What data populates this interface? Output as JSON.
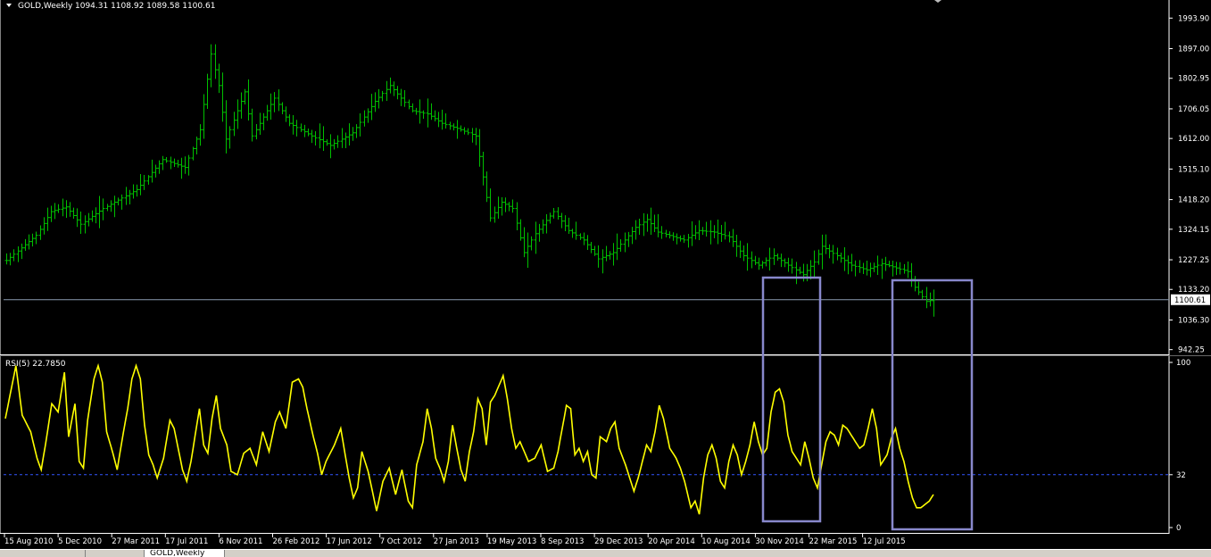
{
  "header": {
    "symbol": "GOLD,Weekly",
    "ohlc": "1094.31 1108.92 1089.58 1100.61"
  },
  "colors": {
    "background": "#000000",
    "bars": "#00c000",
    "rsi": "#ffff00",
    "level": "#3355ff",
    "price_line": "#8a9bb0",
    "box": "#8888cc",
    "axis_text": "#ffffff",
    "separator": "#ffffff"
  },
  "tabs": [
    "",
    "",
    "GOLD,Weekly"
  ],
  "chart_data": [
    {
      "type": "ohlc",
      "title": "GOLD,Weekly",
      "x_axis_labels": [
        "15 Aug 2010",
        "5 Dec 2010",
        "27 Mar 2011",
        "17 Jul 2011",
        "6 Nov 2011",
        "26 Feb 2012",
        "17 Jun 2012",
        "7 Oct 2012",
        "27 Jan 2013",
        "19 May 2013",
        "8 Sep 2013",
        "29 Dec 2013",
        "20 Apr 2014",
        "10 Aug 2014",
        "30 Nov 2014",
        "22 Mar 2015",
        "12 Jul 2015"
      ],
      "y_ticks": [
        "1993.90",
        "1897.00",
        "1802.95",
        "1706.05",
        "1612.00",
        "1515.10",
        "1418.20",
        "1324.15",
        "1227.25",
        "1133.20",
        "1036.30",
        "942.25"
      ],
      "ylim": [
        930,
        2040
      ],
      "current_price": 1100.61,
      "current_price_label": "1100.61",
      "anchors": [
        [
          0,
          1225
        ],
        [
          8,
          1305
        ],
        [
          12,
          1380
        ],
        [
          16,
          1395
        ],
        [
          20,
          1340
        ],
        [
          26,
          1390
        ],
        [
          35,
          1450
        ],
        [
          42,
          1545
        ],
        [
          48,
          1520
        ],
        [
          52,
          1640
        ],
        [
          55,
          1880
        ],
        [
          57,
          1780
        ],
        [
          59,
          1610
        ],
        [
          62,
          1700
        ],
        [
          64,
          1760
        ],
        [
          66,
          1620
        ],
        [
          70,
          1700
        ],
        [
          72,
          1740
        ],
        [
          76,
          1660
        ],
        [
          82,
          1620
        ],
        [
          87,
          1590
        ],
        [
          93,
          1630
        ],
        [
          99,
          1730
        ],
        [
          103,
          1780
        ],
        [
          109,
          1700
        ],
        [
          113,
          1690
        ],
        [
          117,
          1660
        ],
        [
          122,
          1640
        ],
        [
          126,
          1620
        ],
        [
          130,
          1360
        ],
        [
          133,
          1410
        ],
        [
          136,
          1390
        ],
        [
          139,
          1250
        ],
        [
          142,
          1310
        ],
        [
          147,
          1380
        ],
        [
          151,
          1320
        ],
        [
          155,
          1290
        ],
        [
          159,
          1230
        ],
        [
          163,
          1250
        ],
        [
          169,
          1330
        ],
        [
          172,
          1355
        ],
        [
          175,
          1315
        ],
        [
          182,
          1290
        ],
        [
          186,
          1320
        ],
        [
          190,
          1315
        ],
        [
          194,
          1300
        ],
        [
          198,
          1240
        ],
        [
          202,
          1210
        ],
        [
          206,
          1240
        ],
        [
          210,
          1210
        ],
        [
          214,
          1180
        ],
        [
          217,
          1220
        ],
        [
          219,
          1270
        ],
        [
          223,
          1240
        ],
        [
          227,
          1210
        ],
        [
          231,
          1195
        ],
        [
          235,
          1215
        ],
        [
          238,
          1205
        ],
        [
          242,
          1190
        ],
        [
          244,
          1140
        ],
        [
          247,
          1095
        ],
        [
          249,
          1100
        ]
      ],
      "n_bars": 250
    },
    {
      "type": "line",
      "title": "RSI(5) 22.7850",
      "ylim": [
        0,
        100
      ],
      "y_ticks": [
        "100",
        "32",
        "0"
      ],
      "level": 32,
      "anchors": [
        [
          0,
          66
        ],
        [
          5,
          98
        ],
        [
          8,
          68
        ],
        [
          12,
          58
        ],
        [
          15,
          42
        ],
        [
          17,
          35
        ],
        [
          19,
          50
        ],
        [
          22,
          75
        ],
        [
          25,
          70
        ],
        [
          28,
          94
        ],
        [
          30,
          55
        ],
        [
          33,
          75
        ],
        [
          35,
          40
        ],
        [
          37,
          36
        ],
        [
          39,
          65
        ],
        [
          42,
          90
        ],
        [
          44,
          98
        ],
        [
          46,
          88
        ],
        [
          48,
          58
        ],
        [
          51,
          45
        ],
        [
          53,
          35
        ],
        [
          56,
          58
        ],
        [
          58,
          72
        ],
        [
          60,
          90
        ],
        [
          62,
          98
        ],
        [
          64,
          90
        ],
        [
          66,
          62
        ],
        [
          68,
          44
        ],
        [
          70,
          38
        ],
        [
          72,
          30
        ],
        [
          75,
          42
        ],
        [
          78,
          65
        ],
        [
          80,
          60
        ],
        [
          84,
          35
        ],
        [
          86,
          28
        ],
        [
          88,
          40
        ],
        [
          90,
          56
        ],
        [
          92,
          72
        ],
        [
          94,
          50
        ],
        [
          96,
          45
        ],
        [
          98,
          66
        ],
        [
          100,
          80
        ],
        [
          102,
          60
        ],
        [
          105,
          50
        ],
        [
          107,
          34
        ],
        [
          110,
          32
        ],
        [
          113,
          45
        ],
        [
          116,
          48
        ],
        [
          119,
          38
        ],
        [
          122,
          58
        ],
        [
          125,
          46
        ],
        [
          128,
          64
        ],
        [
          130,
          70
        ],
        [
          133,
          60
        ],
        [
          136,
          88
        ],
        [
          139,
          90
        ],
        [
          141,
          85
        ],
        [
          143,
          72
        ],
        [
          146,
          55
        ],
        [
          148,
          45
        ],
        [
          150,
          32
        ],
        [
          152,
          40
        ],
        [
          156,
          50
        ],
        [
          159,
          60
        ],
        [
          161,
          45
        ],
        [
          163,
          30
        ],
        [
          165,
          18
        ],
        [
          167,
          24
        ],
        [
          169,
          46
        ],
        [
          172,
          34
        ],
        [
          174,
          22
        ],
        [
          176,
          10
        ],
        [
          179,
          28
        ],
        [
          182,
          36
        ],
        [
          185,
          20
        ],
        [
          188,
          35
        ],
        [
          191,
          16
        ],
        [
          193,
          12
        ],
        [
          195,
          38
        ],
        [
          198,
          52
        ],
        [
          200,
          72
        ],
        [
          202,
          60
        ],
        [
          204,
          42
        ],
        [
          206,
          36
        ],
        [
          208,
          28
        ],
        [
          210,
          40
        ],
        [
          212,
          62
        ],
        [
          214,
          48
        ],
        [
          216,
          35
        ],
        [
          218,
          28
        ],
        [
          220,
          46
        ],
        [
          222,
          58
        ],
        [
          224,
          78
        ],
        [
          226,
          72
        ],
        [
          228,
          50
        ],
        [
          230,
          76
        ],
        [
          232,
          80
        ],
        [
          234,
          86
        ],
        [
          236,
          92
        ],
        [
          238,
          78
        ],
        [
          240,
          60
        ],
        [
          242,
          48
        ],
        [
          244,
          52
        ],
        [
          246,
          46
        ],
        [
          248,
          40
        ],
        [
          251,
          42
        ],
        [
          254,
          50
        ],
        [
          257,
          34
        ],
        [
          260,
          36
        ],
        [
          262,
          46
        ],
        [
          264,
          60
        ],
        [
          266,
          74
        ],
        [
          268,
          72
        ],
        [
          270,
          44
        ],
        [
          272,
          48
        ],
        [
          274,
          40
        ],
        [
          276,
          46
        ],
        [
          278,
          32
        ],
        [
          280,
          30
        ],
        [
          282,
          55
        ],
        [
          285,
          52
        ],
        [
          287,
          60
        ],
        [
          289,
          64
        ],
        [
          291,
          48
        ],
        [
          294,
          38
        ],
        [
          296,
          30
        ],
        [
          298,
          22
        ],
        [
          300,
          30
        ],
        [
          302,
          40
        ],
        [
          304,
          50
        ],
        [
          306,
          46
        ],
        [
          308,
          58
        ],
        [
          310,
          74
        ],
        [
          312,
          66
        ],
        [
          315,
          48
        ],
        [
          318,
          42
        ],
        [
          320,
          36
        ],
        [
          322,
          28
        ],
        [
          325,
          12
        ],
        [
          327,
          16
        ],
        [
          329,
          8
        ],
        [
          331,
          30
        ],
        [
          333,
          44
        ],
        [
          335,
          50
        ],
        [
          337,
          42
        ],
        [
          339,
          28
        ],
        [
          341,
          24
        ],
        [
          343,
          40
        ],
        [
          345,
          50
        ],
        [
          347,
          44
        ],
        [
          349,
          32
        ],
        [
          351,
          40
        ],
        [
          353,
          50
        ],
        [
          355,
          64
        ],
        [
          357,
          52
        ],
        [
          359,
          44
        ],
        [
          361,
          48
        ],
        [
          363,
          70
        ],
        [
          365,
          82
        ],
        [
          367,
          84
        ],
        [
          369,
          76
        ],
        [
          371,
          56
        ],
        [
          373,
          46
        ],
        [
          375,
          42
        ],
        [
          377,
          38
        ],
        [
          379,
          52
        ],
        [
          381,
          42
        ],
        [
          383,
          30
        ],
        [
          385,
          24
        ],
        [
          387,
          38
        ],
        [
          389,
          52
        ],
        [
          391,
          58
        ],
        [
          393,
          56
        ],
        [
          395,
          50
        ],
        [
          397,
          62
        ],
        [
          399,
          60
        ],
        [
          401,
          56
        ],
        [
          403,
          52
        ],
        [
          405,
          48
        ],
        [
          407,
          50
        ],
        [
          409,
          60
        ],
        [
          411,
          72
        ],
        [
          413,
          60
        ],
        [
          415,
          38
        ],
        [
          418,
          44
        ],
        [
          420,
          54
        ],
        [
          422,
          60
        ],
        [
          424,
          48
        ],
        [
          426,
          40
        ],
        [
          428,
          28
        ],
        [
          430,
          18
        ],
        [
          432,
          12
        ],
        [
          434,
          12
        ],
        [
          436,
          14
        ],
        [
          438,
          16
        ],
        [
          440,
          20
        ]
      ],
      "n_points": 441
    }
  ],
  "annotations": [
    {
      "from": "10 Aug 2014",
      "to": "30 Nov 2014",
      "label": ""
    },
    {
      "from": "22 Mar 2015",
      "to": "12 Jul 2015",
      "label": ""
    }
  ]
}
